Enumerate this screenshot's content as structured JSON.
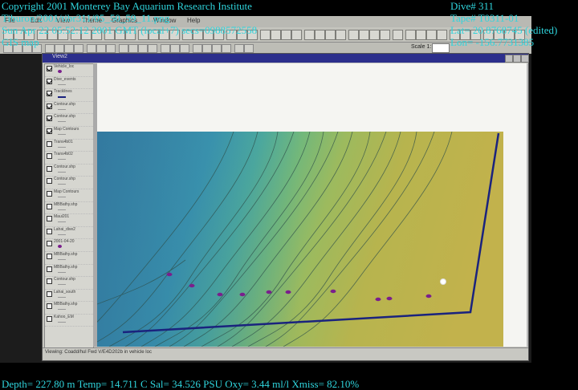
{
  "overlay": {
    "copyright": "Copyright 2001 Monterey Bay Aquarium Research Institute",
    "filename": "Tiburon/2001/tibr311/05_50_59_11.png",
    "datetime": "Sun Apr 22 05:52:12 2001 GMT (local+7)  secs=0988572558",
    "gis_label": "GIS map",
    "dive": "Dive# 311",
    "tape": "Tape# T0311-01",
    "lat": "Lat= 20.8768745 (edited)",
    "lon": "Lon= -156.7731385",
    "sensors": "Depth= 227.80 m  Temp= 14.711 C  Sal= 34.526 PSU  Oxy= 3.44 ml/l  Xmiss= 82.10%"
  },
  "app": {
    "menu": [
      "File",
      "Edit",
      "View",
      "Theme",
      "Graphics",
      "Window",
      "Help"
    ],
    "view_title": "View2",
    "scale_label": "Scale 1:",
    "status_text": "Viewing: Coadd/hul Fwd V/E4D202b in vehicle loc"
  },
  "legend": {
    "items": [
      {
        "label": "Vehicle_loc",
        "checked": true,
        "swatch": "point"
      },
      {
        "label": "Dive_events",
        "checked": true,
        "swatch": "none"
      },
      {
        "label": "Tracklines",
        "checked": true,
        "swatch": "line"
      },
      {
        "label": "Contour.shp",
        "checked": true,
        "swatch": "none"
      },
      {
        "label": "Contour.shp",
        "checked": true,
        "swatch": "none"
      },
      {
        "label": "Map Contours",
        "checked": true,
        "swatch": "none"
      },
      {
        "label": "Trans4b01",
        "checked": false,
        "swatch": "none"
      },
      {
        "label": "Trans4b02",
        "checked": false,
        "swatch": "none"
      },
      {
        "label": "Contour.shp",
        "checked": false,
        "swatch": "none"
      },
      {
        "label": "Contour.shp",
        "checked": false,
        "swatch": "none"
      },
      {
        "label": "Map Contours",
        "checked": false,
        "swatch": "none"
      },
      {
        "label": "MBBathy.shp",
        "checked": false,
        "swatch": "none"
      },
      {
        "label": "Maui201",
        "checked": false,
        "swatch": "none"
      },
      {
        "label": "Lahai_dive2",
        "checked": false,
        "swatch": "none"
      },
      {
        "label": "2001-04-20",
        "checked": false,
        "swatch": "point"
      },
      {
        "label": "MBBathy.shp",
        "checked": false,
        "swatch": "none"
      },
      {
        "label": "MBBathy.shp",
        "checked": false,
        "swatch": "none"
      },
      {
        "label": "Contour.shp",
        "checked": false,
        "swatch": "none"
      },
      {
        "label": "Lahai_south",
        "checked": false,
        "swatch": "none"
      },
      {
        "label": "MBBathy.shp",
        "checked": false,
        "swatch": "none"
      },
      {
        "label": "Kahoo_EM",
        "checked": false,
        "swatch": "none"
      }
    ]
  },
  "colors": {
    "overlay_text": "#2fd4dc",
    "track_line": "#1a237e",
    "dive_event": "#7a1f8c",
    "vehicle": "#ffffff"
  }
}
